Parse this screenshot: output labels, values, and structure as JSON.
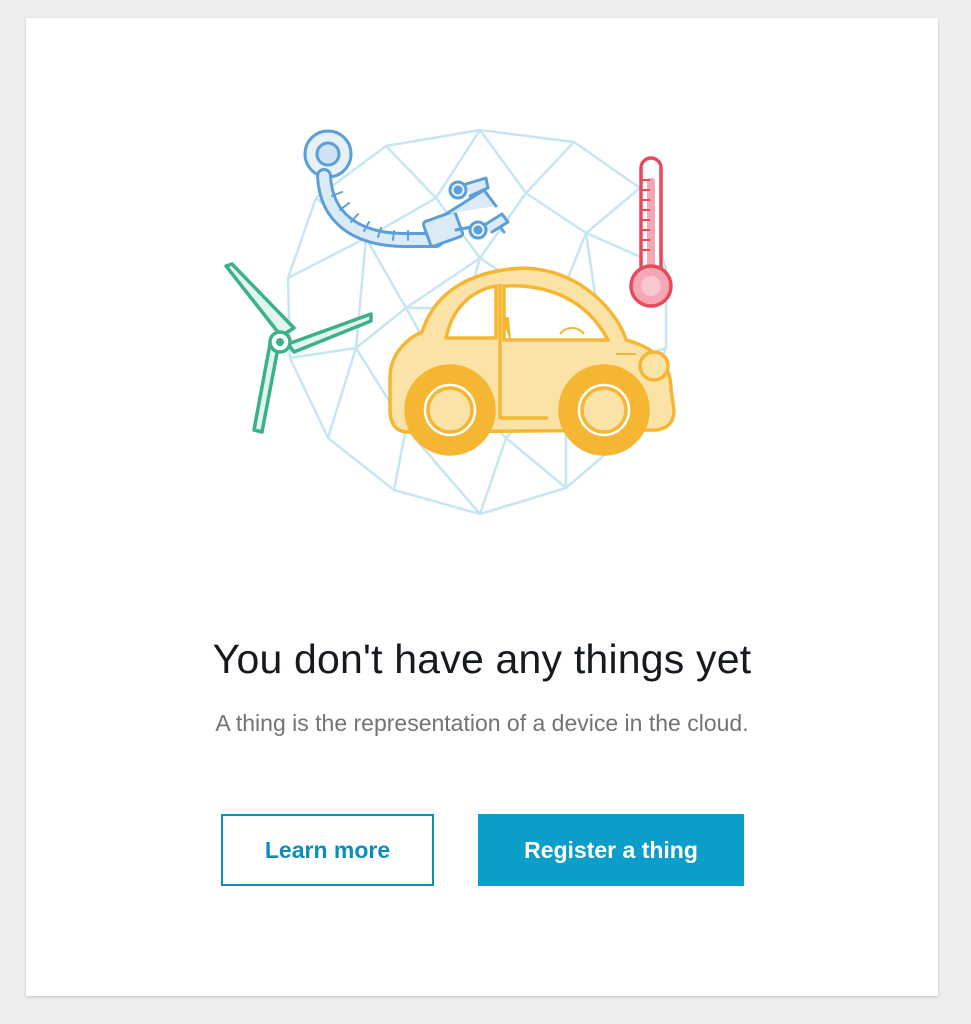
{
  "empty_state": {
    "title": "You don't have any things yet",
    "description": "A thing is the representation of a device in the cloud.",
    "learn_more_label": "Learn more",
    "register_label": "Register a thing"
  },
  "illustration": {
    "icons": [
      "robotic-arm-icon",
      "thermometer-icon",
      "wind-turbine-icon",
      "car-icon",
      "geodesic-sphere-icon"
    ]
  },
  "colors": {
    "primary": "#0a9ec8",
    "secondary_border": "#0a90b8",
    "title": "#16191f",
    "description": "#737373",
    "car": "#f5b733",
    "turbine": "#3ab08b",
    "arm": "#5b9fd9",
    "thermometer": "#e8495b",
    "sphere": "#c6e6f2"
  }
}
